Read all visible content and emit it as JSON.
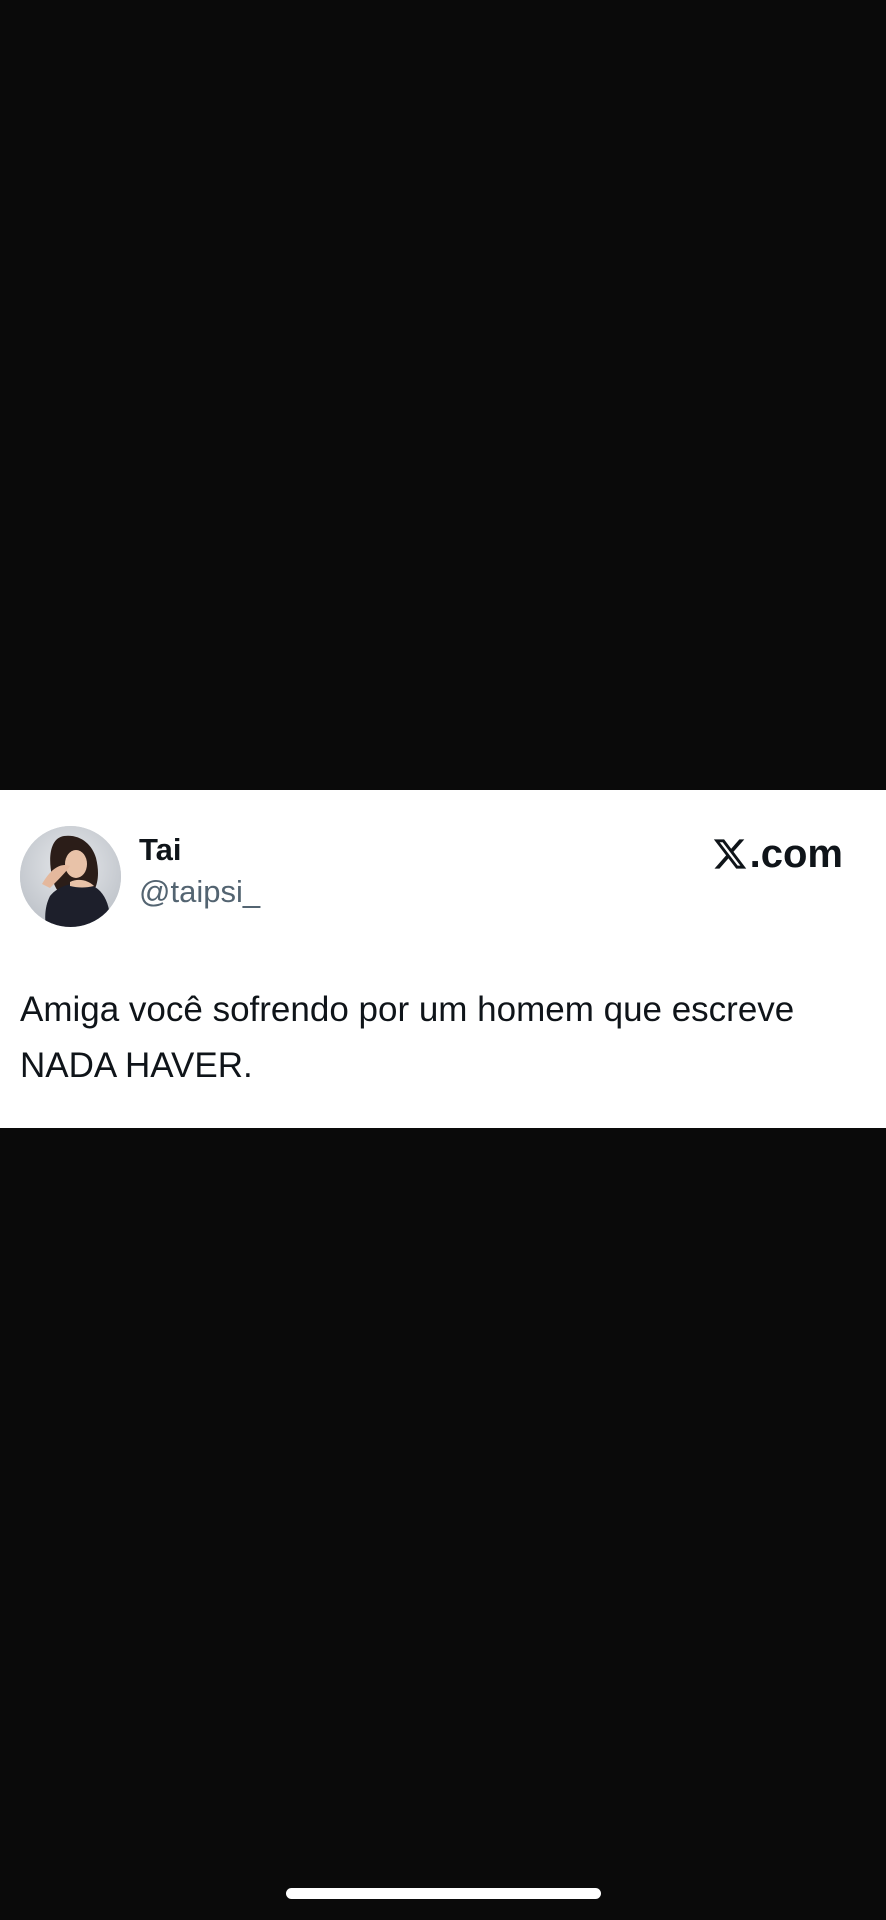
{
  "tweet": {
    "display_name": "Tai",
    "handle": "@taipsi_",
    "text": "Amiga você sofrendo por um homem que escreve\nNADA HAVER.",
    "avatar_icon": "profile-photo"
  },
  "brand": {
    "label": ".com",
    "icon": "x-logo-icon"
  },
  "colors": {
    "background": "#0a0a0a",
    "card": "#ffffff",
    "text": "#0f1419",
    "secondary_text": "#536471"
  }
}
